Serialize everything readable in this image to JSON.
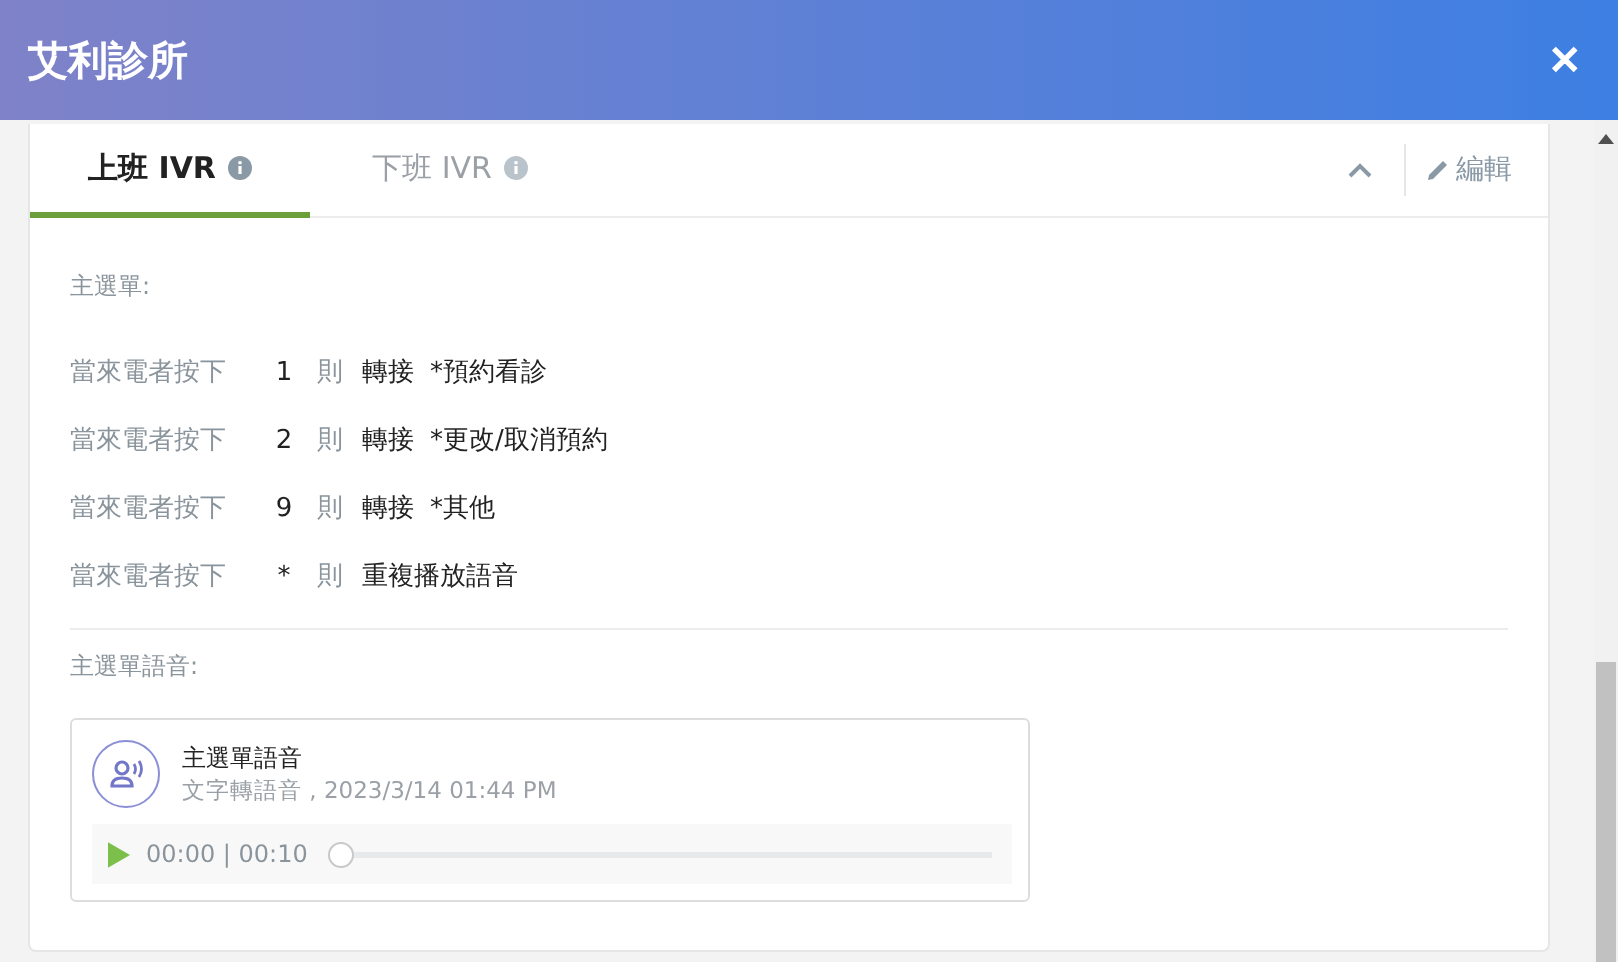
{
  "window": {
    "title": "艾利診所",
    "close": "✕"
  },
  "tabs": [
    {
      "label": "上班 IVR",
      "selected": true
    },
    {
      "label": "下班 IVR",
      "selected": false
    }
  ],
  "edit_label": "編輯",
  "menu_label": "主選單:",
  "rules": [
    {
      "prefix": "當來電者按下",
      "key": "1",
      "then": "則",
      "action": "轉接",
      "target": "*預約看診"
    },
    {
      "prefix": "當來電者按下",
      "key": "2",
      "then": "則",
      "action": "轉接",
      "target": "*更改/取消預約"
    },
    {
      "prefix": "當來電者按下",
      "key": "9",
      "then": "則",
      "action": "轉接",
      "target": "*其他"
    },
    {
      "prefix": "當來電者按下",
      "key": "*",
      "then": "則",
      "action": "重複播放語音"
    }
  ],
  "voice_label": "主選單語音:",
  "audio": {
    "title": "主選單語音",
    "meta": "文字轉語音 , 2023/3/14 01:44 PM",
    "time": "00:00 | 00:10",
    "level": 0
  }
}
